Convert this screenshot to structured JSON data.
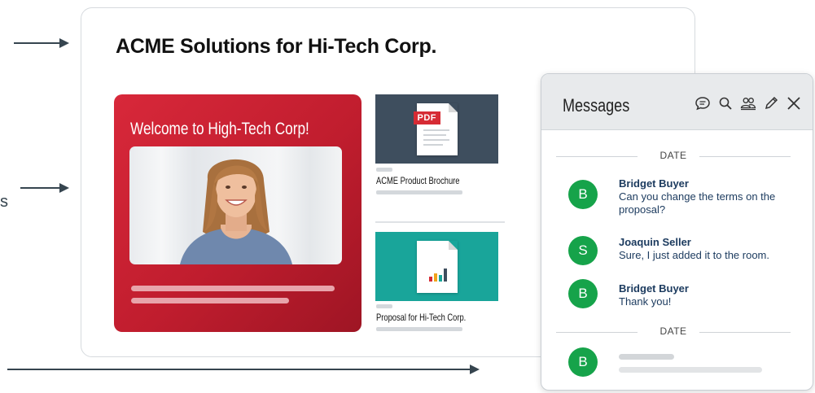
{
  "room": {
    "title": "ACME Solutions for Hi-Tech Corp.",
    "welcome": "Welcome to High-Tech Corp!",
    "documents": [
      {
        "name": "ACME Product Brochure",
        "badge": "PDF"
      },
      {
        "name": "Proposal for Hi-Tech Corp."
      }
    ]
  },
  "edge_text": "s",
  "messages": {
    "title": "Messages",
    "date_label": "DATE",
    "items": [
      {
        "initial": "B",
        "sender": "Bridget Buyer",
        "text": "Can you change the terms on the proposal?"
      },
      {
        "initial": "S",
        "sender": "Joaquin Seller",
        "text": "Sure, I just added it to the room."
      },
      {
        "initial": "B",
        "sender": "Bridget Buyer",
        "text": "Thank you!"
      }
    ],
    "pending": {
      "initial": "B"
    },
    "toolbar_icons": [
      "chat-bubble-icon",
      "search-icon",
      "people-icon",
      "pencil-icon",
      "close-icon"
    ]
  },
  "colors": {
    "brand_red": "#d8283a",
    "avatar_green": "#16a34a",
    "doc_dark": "#3e4e5e",
    "doc_teal": "#19a59a",
    "text_navy": "#1b3a5e"
  }
}
